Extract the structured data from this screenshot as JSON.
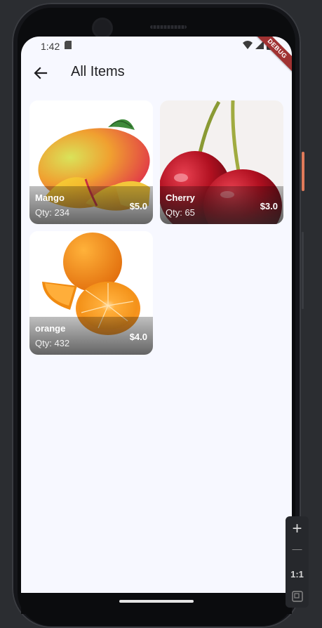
{
  "status_bar": {
    "time": "1:42"
  },
  "debug_banner": "DEBUG",
  "app_bar": {
    "title": "All Items"
  },
  "items": [
    {
      "name": "Mango",
      "qty": "Qty: 234",
      "price": "$5.0"
    },
    {
      "name": "Cherry",
      "qty": "Qty: 65",
      "price": "$3.0"
    },
    {
      "name": "orange",
      "qty": "Qty: 432",
      "price": "$4.0"
    }
  ],
  "zoom_controls": {
    "zoom_in": "+",
    "zoom_out": "—",
    "actual_size": "1:1"
  }
}
